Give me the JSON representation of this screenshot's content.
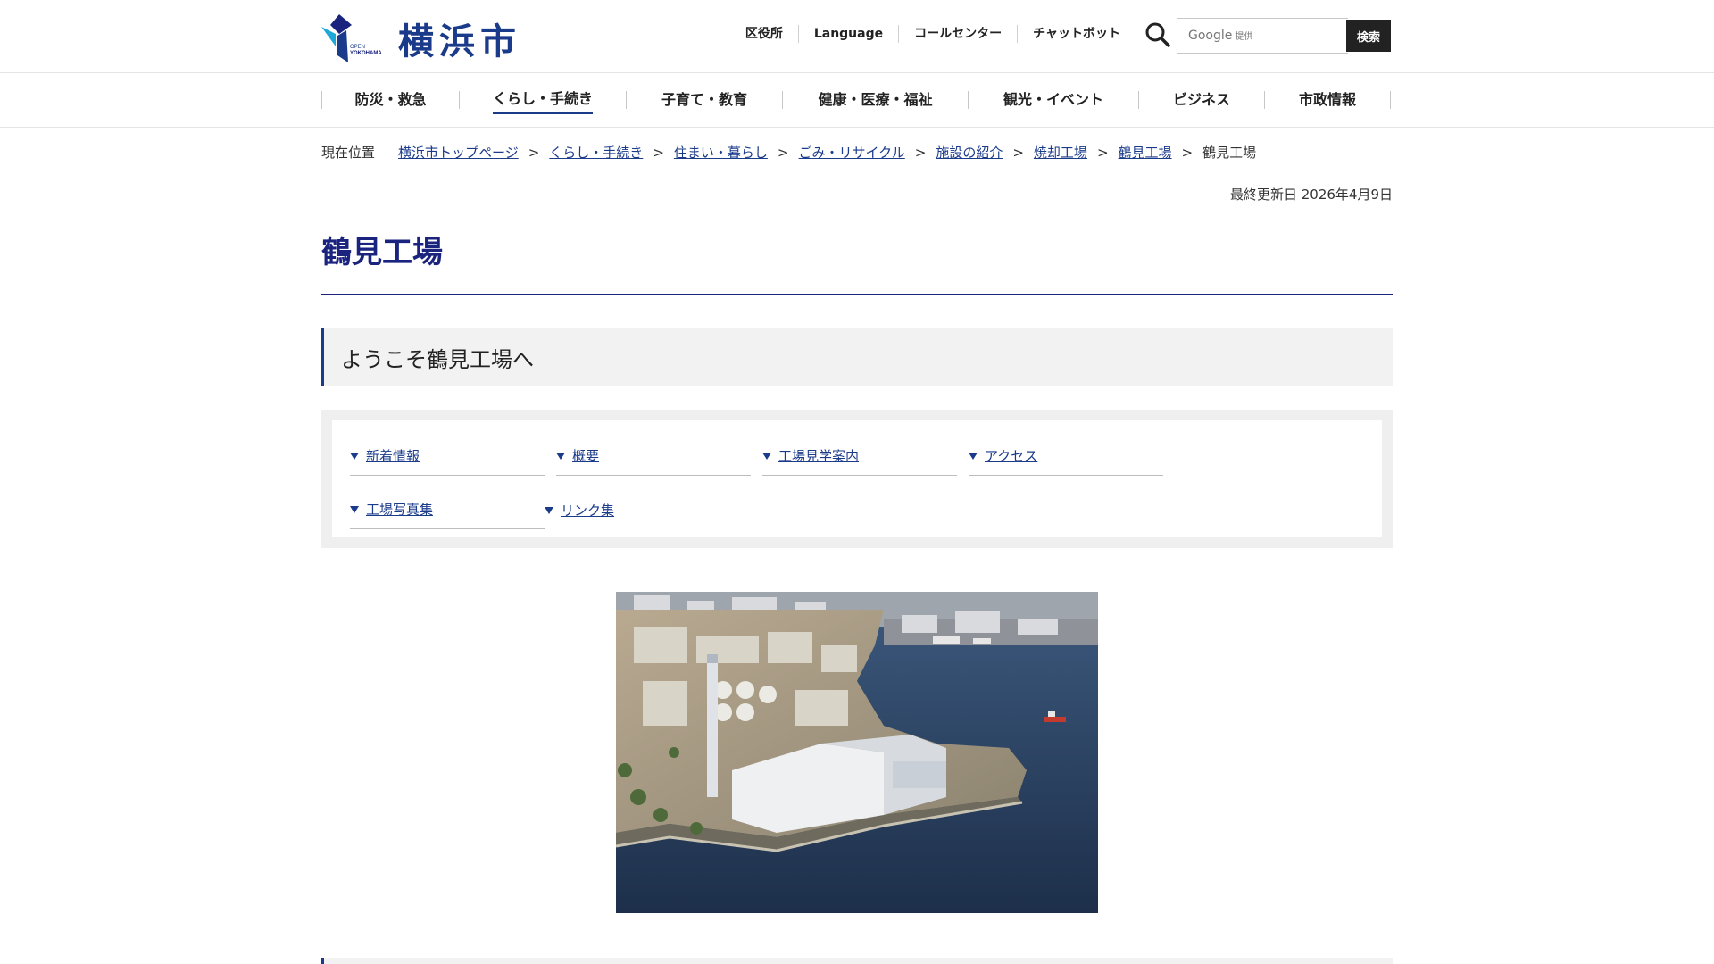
{
  "header": {
    "logo_text": "横浜市",
    "logo_sub": "OPEN YOKOHAMA",
    "util_links": [
      "区役所",
      "Language",
      "コールセンター",
      "チャットボット"
    ],
    "search": {
      "placeholder": "Google 提供",
      "google_label": "Google",
      "provider_label": "提供",
      "button_label": "検索"
    }
  },
  "gnav": {
    "items": [
      {
        "label": "防災・救急",
        "active": false
      },
      {
        "label": "くらし・手続き",
        "active": true
      },
      {
        "label": "子育て・教育",
        "active": false
      },
      {
        "label": "健康・医療・福祉",
        "active": false
      },
      {
        "label": "観光・イベント",
        "active": false
      },
      {
        "label": "ビジネス",
        "active": false
      },
      {
        "label": "市政情報",
        "active": false
      }
    ]
  },
  "breadcrumb": {
    "label": "現在位置",
    "items": [
      "横浜市トップページ",
      "くらし・手続き",
      "住まい・暮らし",
      "ごみ・リサイクル",
      "施設の紹介",
      "焼却工場",
      "鶴見工場"
    ],
    "current": "鶴見工場",
    "separator": ">"
  },
  "updated": "最終更新日 2026年4月9日",
  "page_title": "鶴見工場",
  "section_heading": "ようこそ鶴見工場へ",
  "anchors": [
    "新着情報",
    "概要",
    "工場見学案内",
    "アクセス",
    "工場写真集",
    "リンク集"
  ],
  "colors": {
    "brand": "#1a3a8a",
    "title": "#1a237e",
    "heading_bg": "#f2f2f2"
  }
}
